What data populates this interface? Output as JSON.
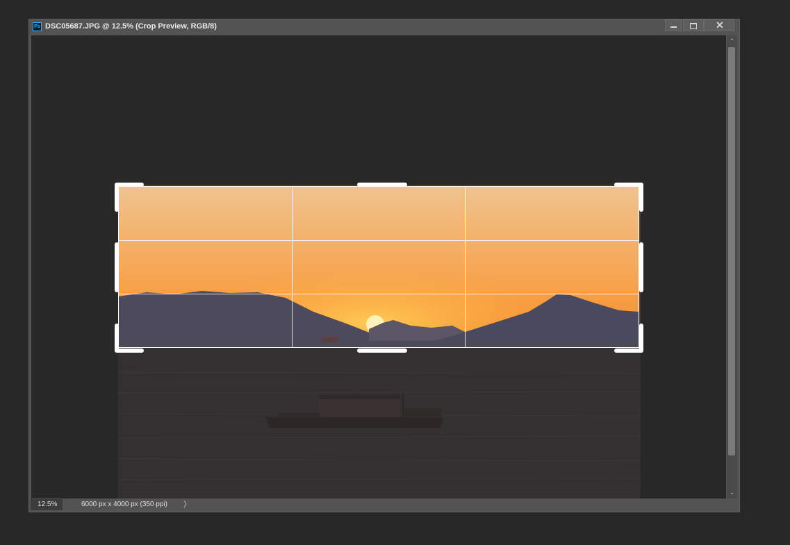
{
  "window": {
    "title": "DSC05687.JPG @ 12.5% (Crop Preview, RGB/8)",
    "app_icon_label": "Ps",
    "controls": {
      "minimize": "minimize-icon",
      "maximize": "maximize-icon",
      "close": "✕"
    }
  },
  "status": {
    "zoom": "12.5%",
    "doc_info": "6000 px x 4000 px (350 ppi)",
    "arrow": "〉"
  },
  "scrollbar": {
    "up": "⌃",
    "down": "⌄"
  },
  "colors": {
    "workspace": "#282828",
    "window_chrome": "#535353",
    "crop_guides": "#ffffff",
    "sky_top": "#eec38f",
    "sky_mid": "#f7a545",
    "sun": "#fff2b8"
  }
}
